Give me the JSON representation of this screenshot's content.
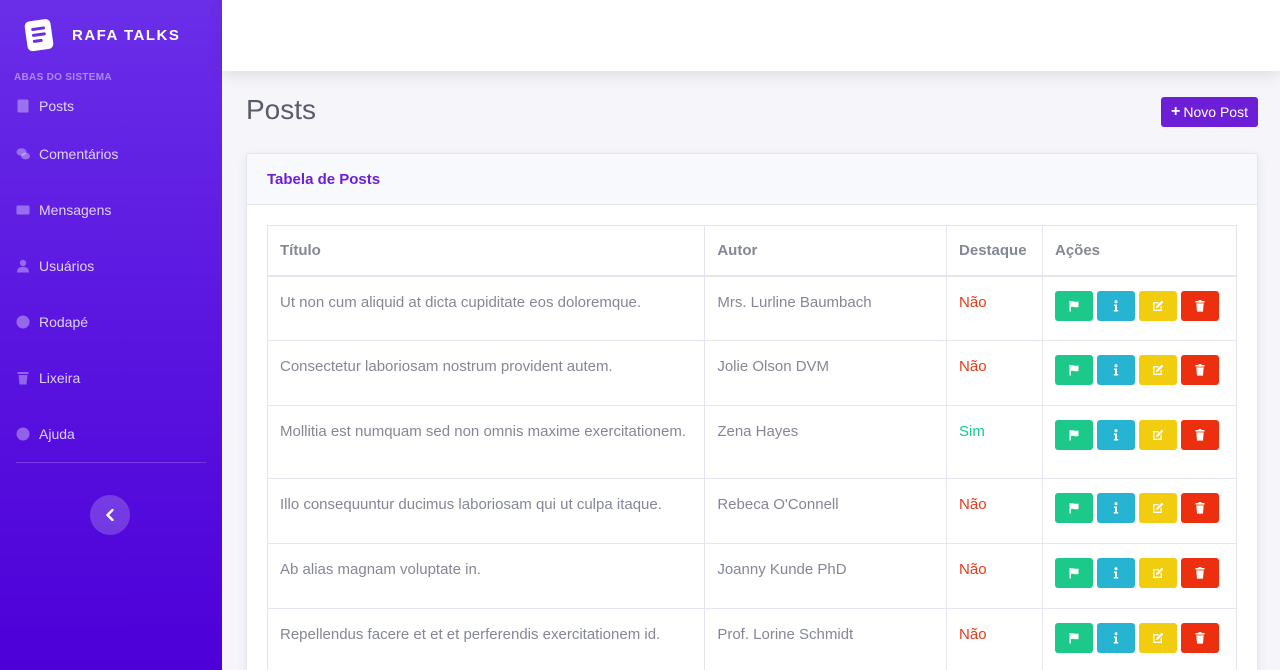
{
  "brand": {
    "name": "RAFA TALKS"
  },
  "sidebar": {
    "heading": "ABAS DO SISTEMA",
    "items": [
      {
        "label": "Posts",
        "icon": "book-icon"
      },
      {
        "label": "Comentários",
        "icon": "comments-icon"
      },
      {
        "label": "Mensagens",
        "icon": "envelope-icon"
      },
      {
        "label": "Usuários",
        "icon": "user-icon"
      },
      {
        "label": "Rodapé",
        "icon": "info-circle-icon"
      },
      {
        "label": "Lixeira",
        "icon": "trash-icon"
      },
      {
        "label": "Ajuda",
        "icon": "question-circle-icon"
      }
    ],
    "toggle_icon": "chevron-left-icon"
  },
  "page": {
    "title": "Posts",
    "new_button": "Novo Post",
    "new_button_icon": "plus-icon"
  },
  "card": {
    "title": "Tabela de Posts"
  },
  "table": {
    "headers": [
      "Título",
      "Autor",
      "Destaque",
      "Ações"
    ],
    "rows": [
      {
        "titulo": "Ut non cum aliquid at dicta cupiditate eos doloremque.",
        "autor": "Mrs. Lurline Baumbach",
        "destaque": "Não"
      },
      {
        "titulo": "Consectetur laboriosam nostrum provident autem.",
        "autor": "Jolie Olson DVM",
        "destaque": "Não"
      },
      {
        "titulo": "Mollitia est numquam sed non omnis maxime exercitationem.",
        "autor": "Zena Hayes",
        "destaque": "Sim"
      },
      {
        "titulo": "Illo consequuntur ducimus laboriosam qui ut culpa itaque.",
        "autor": "Rebeca O'Connell",
        "destaque": "Não"
      },
      {
        "titulo": "Ab alias magnam voluptate in.",
        "autor": "Joanny Kunde PhD",
        "destaque": "Não"
      },
      {
        "titulo": "Repellendus facere et et et perferendis exercitationem id.",
        "autor": "Prof. Lorine Schmidt",
        "destaque": "Não"
      }
    ],
    "action_icons": [
      "flag-icon",
      "info-icon",
      "edit-icon",
      "trash-icon"
    ]
  },
  "colors": {
    "sidebar_top": "#6a2ee8",
    "sidebar_bottom": "#4d00d8",
    "primary": "#6d1fd8",
    "success": "#1cc88a",
    "info": "#27b4d3",
    "warning": "#f2cc0f",
    "danger": "#ec2f0e"
  }
}
